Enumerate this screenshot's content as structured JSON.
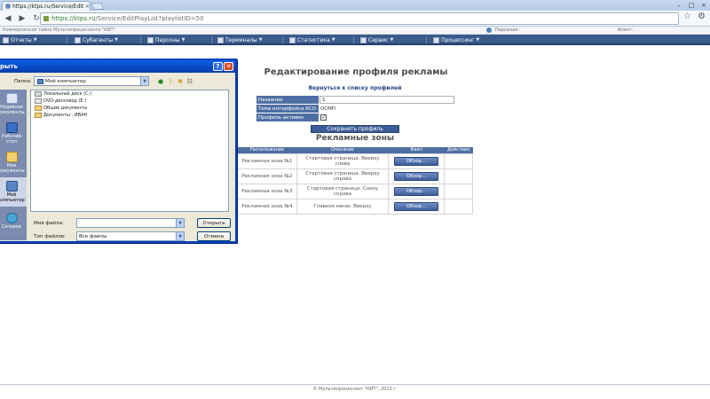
{
  "browser": {
    "tab_title": "https://ktps.ru/Service/EditPl",
    "tab_close": "×",
    "url_scheme_host": "https://ktps.ru",
    "url_path": "/Service/EditPlayList?playlistID=50",
    "window_controls": [
      "–",
      "□",
      "×"
    ]
  },
  "infobar": {
    "site_name": "Коммерческая тайна Мультипроцессинга \"КИТ\"",
    "user_label": "Персонал:",
    "role_label": "Агент:"
  },
  "menu": {
    "items": [
      {
        "label": "Отчеты"
      },
      {
        "label": "Субагенты"
      },
      {
        "label": "Персоны"
      },
      {
        "label": "Терминалы"
      },
      {
        "label": "Статистика"
      },
      {
        "label": "Сервис"
      },
      {
        "label": "Процессинг"
      }
    ],
    "dropdown_glyph": "▼"
  },
  "main": {
    "title": "Редактирование профиля рекламы",
    "back_link": "Вернуться к списку профилей",
    "form": {
      "name_label": "Название",
      "name_value": "1",
      "theme_label": "Тема интерфейса АСО",
      "theme_value": "ОСМП",
      "active_label": "Профиль активен",
      "active_mark": "✓"
    },
    "save_button": "Сохранить профиль",
    "zones_title": "Рекламные зоны",
    "zones_table": {
      "headers": [
        "Расположение",
        "Описание",
        "Файл",
        "Действия"
      ],
      "rows": [
        {
          "location": "Рекламная зона №1",
          "description": "Стартовая страница. Вверху слева",
          "file_button": "Обзор..."
        },
        {
          "location": "Рекламная зона №2",
          "description": "Стартовая страница. Вверху справа",
          "file_button": "Обзор..."
        },
        {
          "location": "Рекламная зона №3",
          "description": "Стартовая страница. Снизу справа",
          "file_button": "Обзор..."
        },
        {
          "location": "Рекламная зона №4",
          "description": "Главное меню. Вверху",
          "file_button": "Обзор..."
        }
      ]
    }
  },
  "footer": {
    "text": "© Мультипроцессинг \"КИТ\", 2012 г."
  },
  "dialog": {
    "title": "рыть",
    "help_glyph": "?",
    "close_glyph": "✕",
    "look_in_label": "Папка:",
    "look_in_value": "Мой компьютер",
    "places": [
      {
        "label": "Недавние документы"
      },
      {
        "label": "Рабочий стол"
      },
      {
        "label": "Мои документы"
      },
      {
        "label": "Мой компьютер"
      },
      {
        "label": "Сетевое"
      }
    ],
    "files": [
      {
        "name": "Локальный диск (C:)"
      },
      {
        "name": "DVD-дисковод (E:)"
      },
      {
        "name": "Общие документы"
      },
      {
        "name": "Документы - ИВАН"
      }
    ],
    "filename_label": "Имя файла:",
    "filename_value": "",
    "filetype_label": "Тип файлов:",
    "filetype_value": "Все файлы",
    "open_button": "Открыть",
    "cancel_button": "Отмена"
  }
}
